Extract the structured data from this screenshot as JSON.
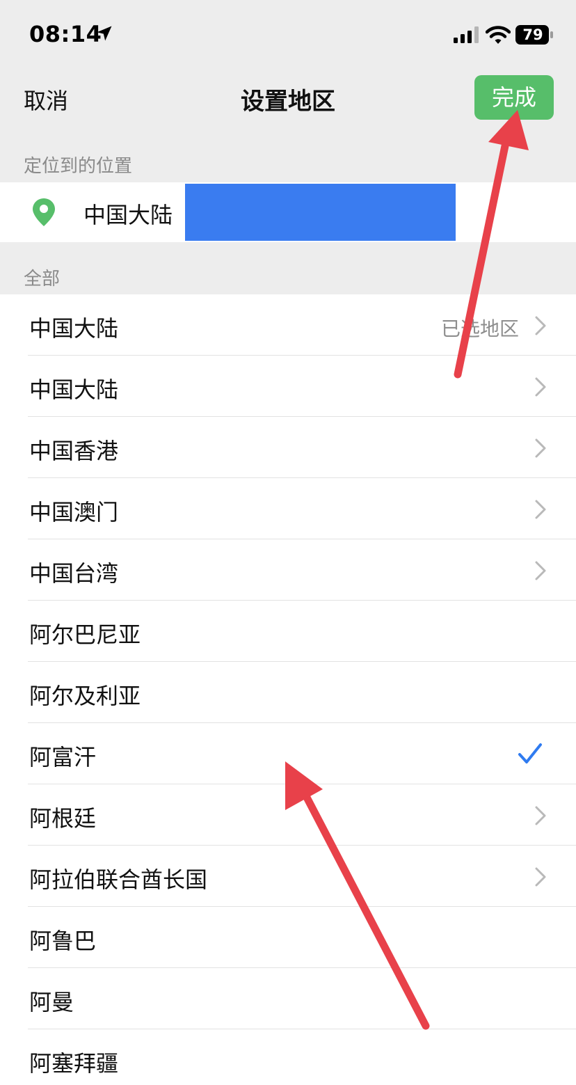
{
  "status_bar": {
    "time": "08:14",
    "battery_level": "79"
  },
  "nav": {
    "cancel_label": "取消",
    "title": "设置地区",
    "done_label": "完成"
  },
  "sections": {
    "located_label": "定位到的位置",
    "all_label": "全部"
  },
  "located": {
    "region": "中国大陆"
  },
  "regions": [
    {
      "name": "中国大陆",
      "tag": "已选地区",
      "chevron": true,
      "checked": false
    },
    {
      "name": "中国大陆",
      "tag": "",
      "chevron": true,
      "checked": false
    },
    {
      "name": "中国香港",
      "tag": "",
      "chevron": true,
      "checked": false
    },
    {
      "name": "中国澳门",
      "tag": "",
      "chevron": true,
      "checked": false
    },
    {
      "name": "中国台湾",
      "tag": "",
      "chevron": true,
      "checked": false
    },
    {
      "name": "阿尔巴尼亚",
      "tag": "",
      "chevron": false,
      "checked": false
    },
    {
      "name": "阿尔及利亚",
      "tag": "",
      "chevron": false,
      "checked": false
    },
    {
      "name": "阿富汗",
      "tag": "",
      "chevron": false,
      "checked": true
    },
    {
      "name": "阿根廷",
      "tag": "",
      "chevron": true,
      "checked": false
    },
    {
      "name": "阿拉伯联合酋长国",
      "tag": "",
      "chevron": true,
      "checked": false
    },
    {
      "name": "阿鲁巴",
      "tag": "",
      "chevron": false,
      "checked": false
    },
    {
      "name": "阿曼",
      "tag": "",
      "chevron": false,
      "checked": false
    },
    {
      "name": "阿塞拜疆",
      "tag": "",
      "chevron": false,
      "checked": false
    }
  ],
  "icons": {
    "location": "location-arrow-icon",
    "pin": "map-pin-icon",
    "chevron": "chevron-right-icon",
    "check": "checkmark-icon"
  },
  "colors": {
    "accent_green": "#57be6a",
    "check_blue": "#2f7bf0",
    "redaction_blue": "#3a7cf0",
    "annotation_red": "#e8414a"
  }
}
